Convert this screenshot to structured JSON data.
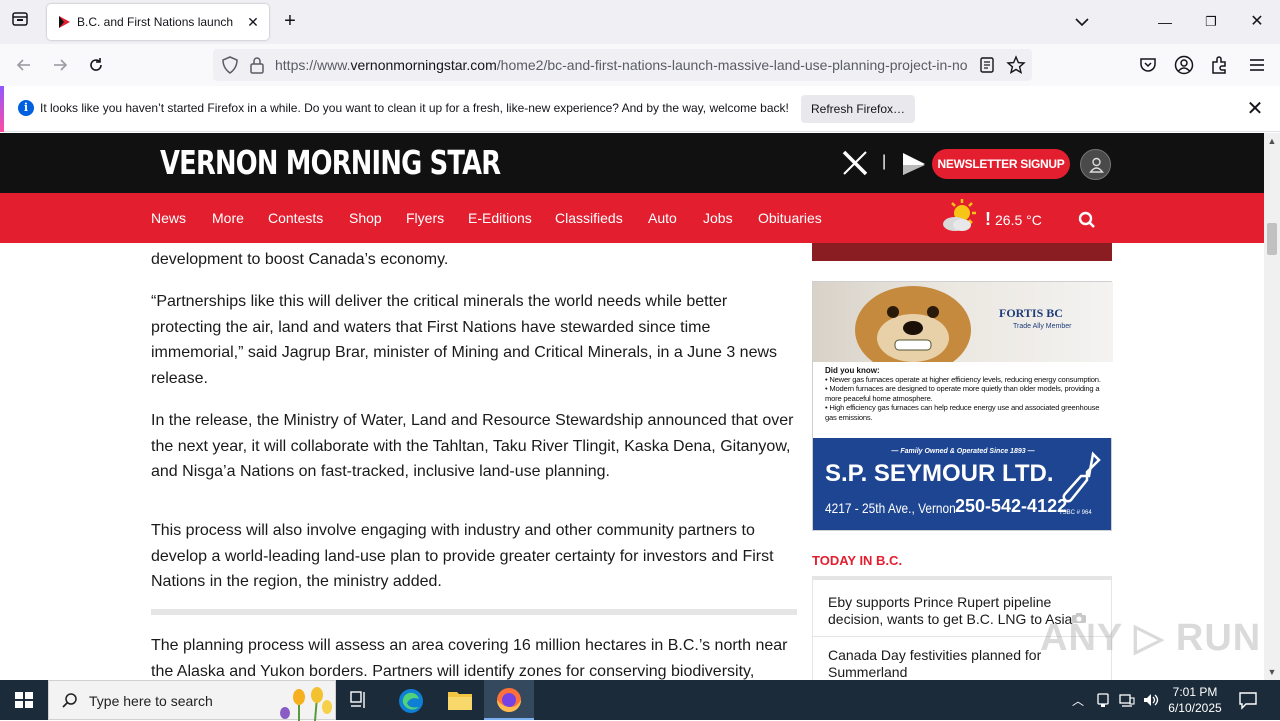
{
  "browser": {
    "tab": {
      "title": "B.C. and First Nations launch massive land-use planning project"
    },
    "url": {
      "prefix": "https://www.",
      "domain": "vernonmorningstar.com",
      "path": "/home2/bc-and-first-nations-launch-massive-land-use-planning-project-in-no"
    }
  },
  "notification": {
    "text": "It looks like you haven’t started Firefox in a while. Do you want to clean it up for a fresh, like-new experience? And by the way, welcome back!",
    "button": "Refresh Firefox…"
  },
  "site": {
    "logo": "VERNON MORNING STAR",
    "separator": "|",
    "newsletter": "NEWSLETTER SIGNUP",
    "nav": [
      "News",
      "More",
      "Contests",
      "Shop",
      "Flyers",
      "E-Editions",
      "Classifieds",
      "Auto",
      "Jobs",
      "Obituaries"
    ],
    "weather": {
      "alert": "!",
      "temp": "26.5 °C"
    }
  },
  "article": {
    "paragraphs": [
      "development to boost Canada’s economy.",
      "“Partnerships like this will deliver the critical minerals the world needs while better protecting the air, land and waters that First Nations have stewarded since time immemorial,” said Jagrup Brar, minister of Mining and Critical Minerals, in a June 3 news release.",
      "In the release, the Ministry of Water, Land and Resource Stewardship announced that over the next year, it will collaborate with the Tahltan, Taku River Tlingit, Kaska Dena, Gitanyow, and Nisga’a Nations on fast-tracked, inclusive land-use planning.",
      "This process will also involve engaging with industry and other community partners to develop a world-leading land-use plan to provide greater certainty for investors and First Nations in the region, the ministry added.",
      "The planning process will assess an area covering 16 million hectares in B.C.’s north near the Alaska and Yukon borders. Partners will identify zones for conserving biodiversity,"
    ]
  },
  "ad": {
    "fortis": "FORTIS BC",
    "fortis_sub": "Trade Ally Member",
    "did_you_know": "Did you know:",
    "bullets": [
      "• Newer gas furnaces operate at higher efficiency levels, reducing energy consumption.",
      "• Modern furnaces are designed to operate more quietly than older models, providing a more peaceful home atmosphere.",
      "• High efficiency gas furnaces can help reduce energy use and associated greenhouse gas emissions."
    ],
    "tagline": "— Family Owned & Operated Since 1893 —",
    "company": "S.P. SEYMOUR LTD.",
    "address": "4217 - 25th Ave., Vernon",
    "phone": "250-542-4122",
    "license": "TSBC # 964"
  },
  "today": {
    "title": "TODAY IN B.C.",
    "items": [
      "Eby supports Prince Rupert pipeline decision, wants to get B.C. LNG to Asia",
      "Canada Day festivities planned for Summerland"
    ]
  },
  "watermark": "ANY ▷ RUN",
  "taskbar": {
    "search_placeholder": "Type here to search",
    "time": "7:01 PM",
    "date": "6/10/2025"
  },
  "colors": {
    "brand_red": "#e31e2f",
    "header_black": "#111111",
    "ad_blue": "#1d4592"
  }
}
